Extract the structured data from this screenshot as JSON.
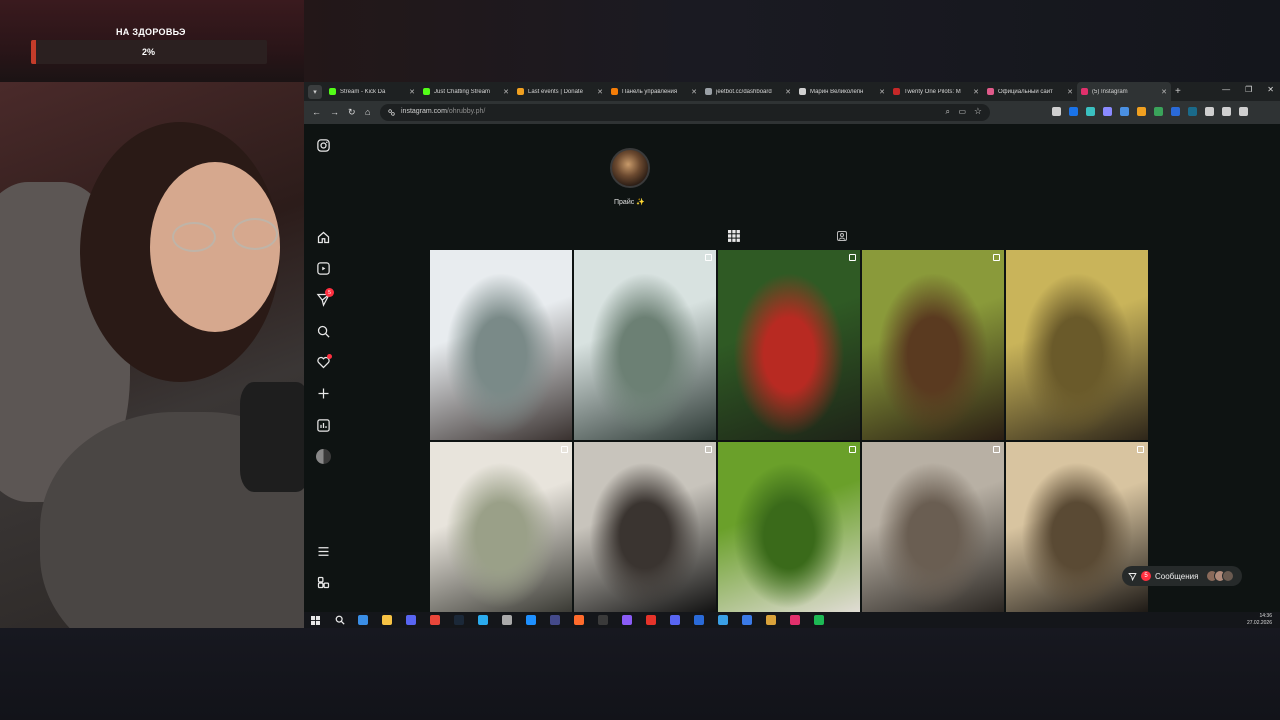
{
  "overlay": {
    "donation_title": "НА ЗДОРОВЬЭ",
    "donation_percent": "2%",
    "donation_progress": 0.02
  },
  "browser": {
    "tabs": [
      {
        "label": "Stream - Kick Da",
        "fav_color": "#53fc18",
        "active": false
      },
      {
        "label": "Just Chatting Stream",
        "fav_color": "#53fc18",
        "active": false
      },
      {
        "label": "Last events | Donate",
        "fav_color": "#f0a020",
        "active": false
      },
      {
        "label": "Панель управления",
        "fav_color": "#f57d07",
        "active": false
      },
      {
        "label": "jeetbot.cc/dashboard",
        "fav_color": "#9aa0a6",
        "active": false
      },
      {
        "label": "Марин Великолепн",
        "fav_color": "#d0d0d0",
        "active": false
      },
      {
        "label": "Twenty One Pilots: M",
        "fav_color": "#c62828",
        "active": false
      },
      {
        "label": "Официальный сайт",
        "fav_color": "#e05a8a",
        "active": false
      },
      {
        "label": "(5) Instagram",
        "fav_color": "#e1306c",
        "active": true
      }
    ],
    "url_host": "instagram.com",
    "url_path": "/ohrubby.ph/"
  },
  "instagram": {
    "highlight_label": "Прайс ✨",
    "messages_label": "Сообщения",
    "messages_badge": "5",
    "notification_badge": "5",
    "posts": [
      {
        "kind": "winter-couple-dog",
        "colors": [
          "#e8ecef",
          "#7a8a88",
          "#3a3230"
        ]
      },
      {
        "kind": "winter-girl",
        "colors": [
          "#d8e2e0",
          "#6c8074",
          "#2e3a36"
        ]
      },
      {
        "kind": "berries-portrait",
        "colors": [
          "#2f5a24",
          "#b82a22",
          "#1e2418"
        ]
      },
      {
        "kind": "dog-owner",
        "colors": [
          "#8a9a3a",
          "#5a3a20",
          "#2a1e14"
        ]
      },
      {
        "kind": "autumn-girl",
        "colors": [
          "#c9b45a",
          "#6a5a2a",
          "#2e261a"
        ]
      },
      {
        "kind": "wedding",
        "colors": [
          "#e8e4dc",
          "#9aa088",
          "#3a3a34"
        ]
      },
      {
        "kind": "man-sofa",
        "colors": [
          "#c8c4bc",
          "#3a3430",
          "#121212"
        ]
      },
      {
        "kind": "couple-grass",
        "colors": [
          "#6aa02a",
          "#3a6a1a",
          "#e0dcd4"
        ]
      },
      {
        "kind": "city-coat",
        "colors": [
          "#b8b0a4",
          "#6a5e52",
          "#2a2622"
        ]
      },
      {
        "kind": "christmas-tree",
        "colors": [
          "#d8c4a0",
          "#5a4a34",
          "#1e1a16"
        ]
      }
    ]
  },
  "taskbar": {
    "time": "14:36",
    "date": "27.02.2026",
    "icons": [
      "#3a8ee6",
      "#f6c244",
      "#5865f2",
      "#e9463a",
      "#1b2838",
      "#2aabee",
      "#aaaaaa",
      "#1e90ff",
      "#444a8a",
      "#ff6b2c",
      "#3a3a3a",
      "#8a5cf6",
      "#e6332a",
      "#5865f2",
      "#2a6ad8",
      "#3aa0e6",
      "#3a7ae6",
      "#d9a23a",
      "#e1306c",
      "#1db954"
    ]
  }
}
